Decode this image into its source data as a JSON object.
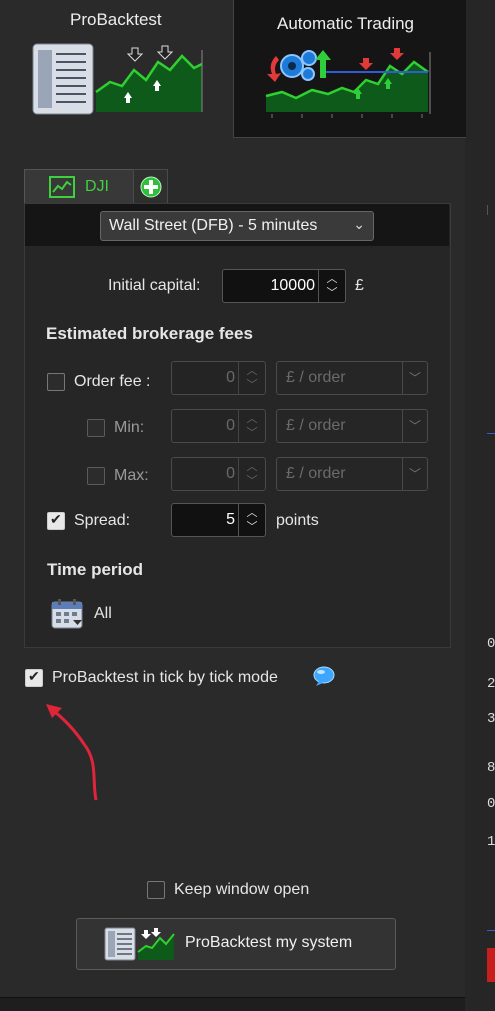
{
  "tabs": [
    {
      "label": "ProBacktest",
      "active": true
    },
    {
      "label": "Automatic Trading",
      "active": false
    }
  ],
  "instrument": {
    "tab_label": "DJI",
    "add_icon": "plus-circle-icon"
  },
  "dropdown": {
    "label": "Wall Street (DFB) - 5 minutes",
    "icon": "chevron-down-icon"
  },
  "capital": {
    "label": "Initial capital:",
    "value": "10000",
    "currency": "£"
  },
  "fees": {
    "heading": "Estimated brokerage fees",
    "order_fee": {
      "label": "Order fee :",
      "value": "0",
      "unit": "£ / order",
      "checked": false
    },
    "min": {
      "label": "Min:",
      "value": "0",
      "unit": "£ / order",
      "checked": false
    },
    "max": {
      "label": "Max:",
      "value": "0",
      "unit": "£ / order",
      "checked": false
    },
    "spread": {
      "label": "Spread:",
      "value": "5",
      "unit": "points",
      "checked": true
    }
  },
  "time_period": {
    "heading": "Time period",
    "value": "All",
    "icon": "calendar-icon"
  },
  "tick_mode": {
    "label": "ProBacktest in tick by tick mode",
    "checked": true,
    "info_icon": "speech-bubble-icon"
  },
  "keep_open": {
    "label": "Keep window open",
    "checked": false
  },
  "run_button": {
    "label": "ProBacktest my system"
  },
  "edge_digits": [
    "0",
    "2",
    "3",
    "8",
    "0",
    "1"
  ],
  "colors": {
    "accent_green": "#3ed13e",
    "annotation_arrow": "#e0253a",
    "info_blue": "#3ea6ff"
  }
}
